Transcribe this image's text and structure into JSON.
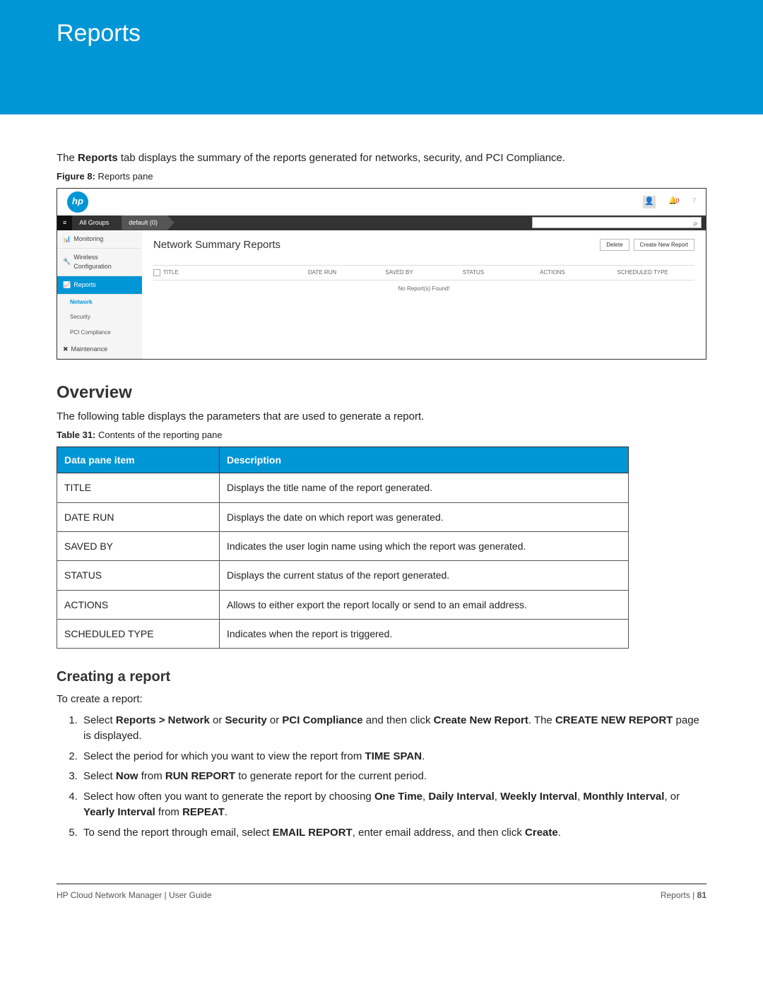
{
  "banner": {
    "title": "Reports"
  },
  "intro": {
    "prefix": "The ",
    "bold": "Reports",
    "suffix": " tab displays the summary of the reports generated for networks, security, and PCI Compliance."
  },
  "figcaption": {
    "label": "Figure 8:",
    "text": " Reports pane"
  },
  "figure": {
    "logo": "hp",
    "notif_count": "0",
    "crumb_allgroups": "All Groups",
    "crumb_default": "default (0)",
    "side_monitoring": "Monitoring",
    "side_wireless": "Wireless Configuration",
    "side_reports": "Reports",
    "side_network": "Network",
    "side_security": "Security",
    "side_pci": "PCI Compliance",
    "side_maintenance": "Maintenance",
    "main_title": "Network Summary Reports",
    "btn_delete": "Delete",
    "btn_create": "Create New Report",
    "col_title": "TITLE",
    "col_daterun": "DATE RUN",
    "col_savedby": "SAVED BY",
    "col_status": "STATUS",
    "col_actions": "ACTIONS",
    "col_schedtype": "SCHEDULED TYPE",
    "no_reports": "No Report(s) Found!"
  },
  "overview_heading": "Overview",
  "overview_text": "The following table displays the parameters that are used to generate a report.",
  "tablecaption": {
    "label": "Table 31:",
    "text": "  Contents of the reporting pane"
  },
  "table": {
    "h1": "Data pane item",
    "h2": "Description",
    "rows": [
      {
        "k": "TITLE",
        "v": "Displays the title name of the report generated."
      },
      {
        "k": "DATE RUN",
        "v": "Displays the date on which report was generated."
      },
      {
        "k": "SAVED BY",
        "v": "Indicates the user login name using which the report was generated."
      },
      {
        "k": "STATUS",
        "v": "Displays the current status of the report generated."
      },
      {
        "k": "ACTIONS",
        "v": "Allows to either export the report locally or send to an email address."
      },
      {
        "k": "SCHEDULED TYPE",
        "v": "Indicates when the report is triggered."
      }
    ]
  },
  "creating_heading": "Creating a report",
  "creating_intro": "To create a report:",
  "steps": {
    "s1a": "Select ",
    "s1b1": "Reports > Network",
    "s1c": " or ",
    "s1b2": "Security",
    "s1d": " or ",
    "s1b3": "PCI Compliance",
    "s1e": " and then click ",
    "s1b4": "Create New Report",
    "s1f": ". The ",
    "s1b5": "CREATE NEW REPORT",
    "s1g": " page is displayed.",
    "s2a": "Select the period for which you want to view the report from ",
    "s2b": "TIME SPAN",
    "s2c": ".",
    "s3a": "Select ",
    "s3b1": "Now",
    "s3c": " from ",
    "s3b2": "RUN REPORT",
    "s3d": " to generate report for the current period.",
    "s4a": "Select how often you want to generate the report by choosing ",
    "s4b1": "One Time",
    "s4c": ", ",
    "s4b2": "Daily Interval",
    "s4d": ", ",
    "s4b3": "Weekly Interval",
    "s4e": ", ",
    "s4b4": "Monthly Interval",
    "s4f": ", or ",
    "s4b5": "Yearly Interval",
    "s4g": " from ",
    "s4b6": "REPEAT",
    "s4h": ".",
    "s5a": "To send the report through email, select ",
    "s5b1": "EMAIL REPORT",
    "s5c": ", enter email address, and then click ",
    "s5b2": "Create",
    "s5d": "."
  },
  "footer": {
    "left": "HP Cloud Network Manager | User Guide",
    "right_label": "Reports  |  ",
    "right_page": "81"
  }
}
